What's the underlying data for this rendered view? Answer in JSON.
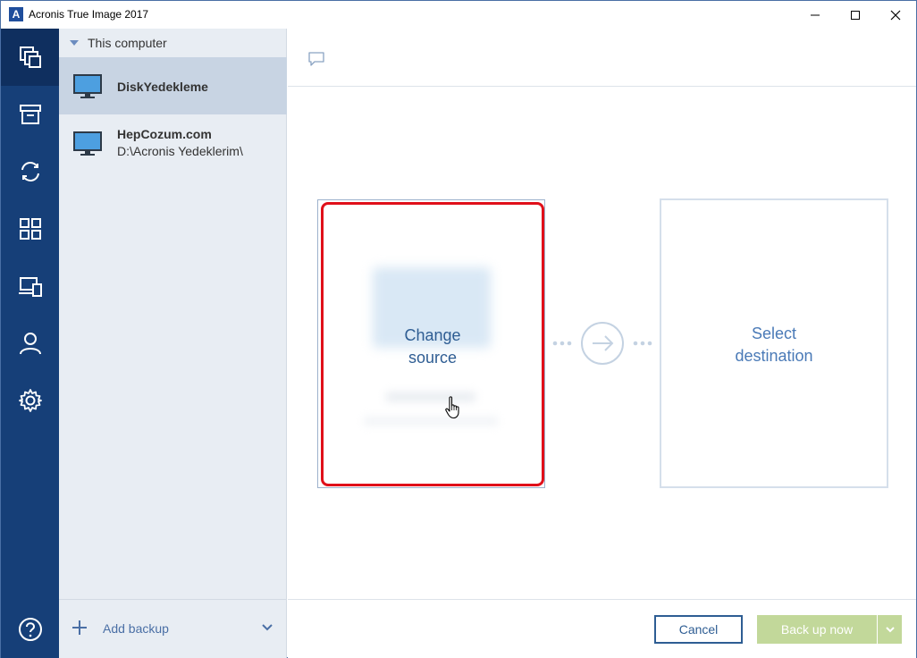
{
  "window": {
    "title": "Acronis True Image 2017",
    "logo_letter": "A"
  },
  "rail": {
    "items": [
      {
        "icon": "backup-icon",
        "active": true
      },
      {
        "icon": "archive-icon"
      },
      {
        "icon": "sync-icon"
      },
      {
        "icon": "dashboard-icon"
      },
      {
        "icon": "tools-icon"
      },
      {
        "icon": "account-icon"
      },
      {
        "icon": "settings-icon"
      },
      {
        "icon": "help-icon"
      }
    ]
  },
  "backup_list": {
    "group_label": "This computer",
    "items": [
      {
        "name": "DiskYedekleme",
        "path": "",
        "selected": true
      },
      {
        "name": "HepCozum.com",
        "path": "D:\\Acronis Yedeklerim\\",
        "selected": false
      }
    ],
    "add_label": "Add backup"
  },
  "main": {
    "source_label_line1": "Change",
    "source_label_line2": "source",
    "dest_label_line1": "Select",
    "dest_label_line2": "destination",
    "cancel_label": "Cancel",
    "backup_now_label": "Back up now"
  },
  "colors": {
    "rail_bg": "#163f78",
    "accent": "#2e5d93",
    "highlight": "#e0101a",
    "backup_btn": "#c2d89a"
  }
}
